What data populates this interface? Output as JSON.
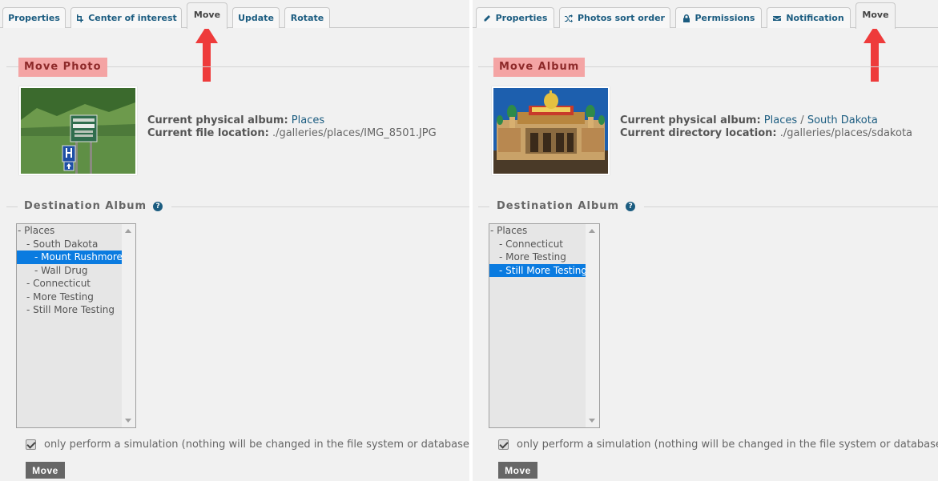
{
  "left": {
    "tabs": [
      {
        "label": "Properties",
        "icon": ""
      },
      {
        "label": "Center of interest",
        "icon": "crop-icon"
      },
      {
        "label": "Move",
        "icon": ""
      },
      {
        "label": "Update",
        "icon": ""
      },
      {
        "label": "Rotate",
        "icon": ""
      }
    ],
    "section_title": "Move Photo",
    "info": {
      "album_label": "Current physical album:",
      "album_value": "Places",
      "location_label": "Current file location:",
      "location_value": "./galleries/places/IMG_8501.JPG"
    },
    "dest_title": "Destination Album",
    "albums": [
      "- Places",
      "- South Dakota",
      "- Mount Rushmore",
      "- Wall Drug",
      "- Connecticut",
      "- More Testing",
      "- Still More Testing"
    ],
    "selected_album": "- Mount Rushmore",
    "simulation_label": "only perform a simulation (nothing will be changed in the file system or database)",
    "move_button": "Move"
  },
  "right": {
    "tabs": [
      {
        "label": "Properties",
        "icon": "pencil-icon"
      },
      {
        "label": "Photos sort order",
        "icon": "shuffle-icon"
      },
      {
        "label": "Permissions",
        "icon": "lock-icon"
      },
      {
        "label": "Notification",
        "icon": "envelope-icon"
      },
      {
        "label": "Move",
        "icon": ""
      }
    ],
    "section_title": "Move Album",
    "info": {
      "album_label": "Current physical album:",
      "album_parent": "Places",
      "album_sep": "/",
      "album_child": "South Dakota",
      "location_label": "Current directory location:",
      "location_value": "./galleries/places/sdakota"
    },
    "dest_title": "Destination Album",
    "albums": [
      "- Places",
      "- Connecticut",
      "- More Testing",
      "- Still More Testing"
    ],
    "selected_album": "- Still More Testing",
    "simulation_label": "only perform a simulation (nothing will be changed in the file system or database)",
    "move_button": "Move"
  },
  "colors": {
    "accent": "#1b5c80",
    "section_bg": "#f4a4a4",
    "selection": "#0a7be0",
    "arrow": "#ee3b3b"
  },
  "help_glyph": "?"
}
